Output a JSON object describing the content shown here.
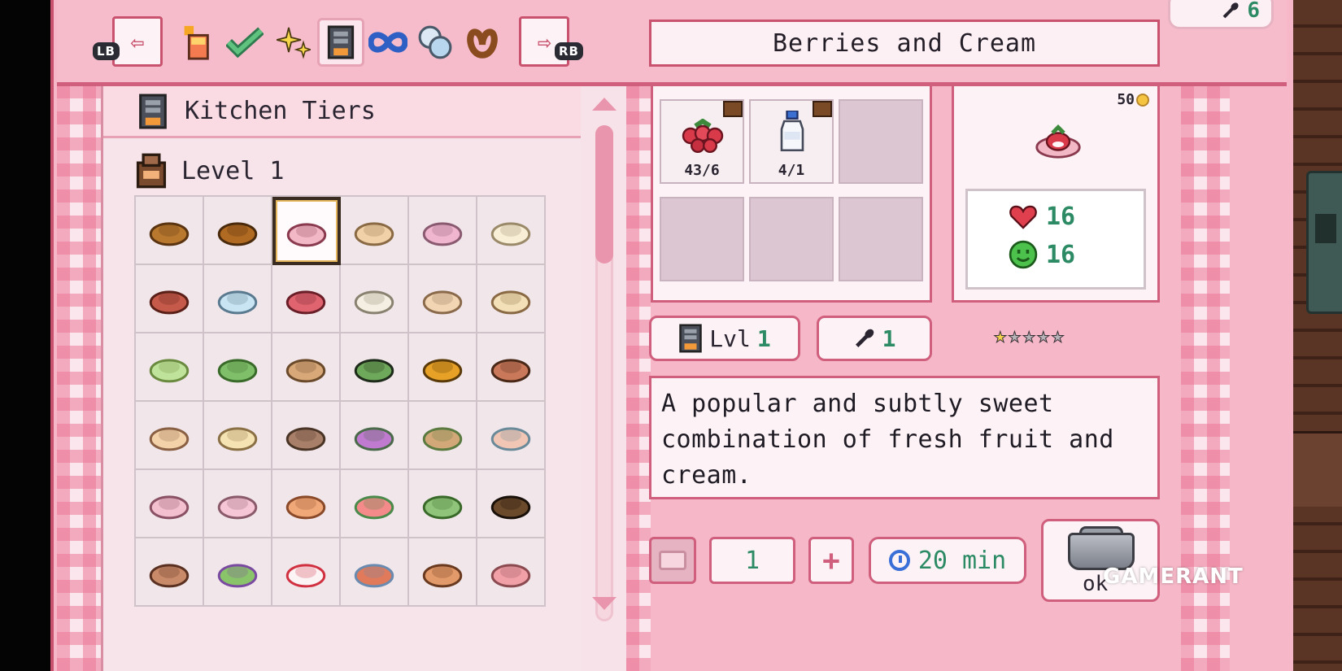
{
  "colors": {
    "accent": "#cf5f7c",
    "panel": "#f6b8c8",
    "value_green": "#2c8b64"
  },
  "topbar": {
    "left_button": {
      "icon": "arrow-left-icon",
      "badge": "LB"
    },
    "right_button": {
      "icon": "arrow-right-icon",
      "badge": "RB"
    },
    "category_tabs": [
      {
        "icon": "drink-icon",
        "selected": false
      },
      {
        "icon": "checkmark-icon",
        "selected": false
      },
      {
        "icon": "sparkle-icon",
        "selected": false
      },
      {
        "icon": "kitchen-tier-icon",
        "selected": true
      },
      {
        "icon": "infinity-icon",
        "selected": false
      },
      {
        "icon": "gems-icon",
        "selected": false
      },
      {
        "icon": "pretzel-icon",
        "selected": false
      }
    ],
    "recipe_title": "Berries and Cream",
    "fork_count": "6"
  },
  "list": {
    "section_title": "Kitchen Tiers",
    "level_title": "Level 1"
  },
  "recipes": [
    {
      "icon": "potato-icon",
      "selected": false
    },
    {
      "icon": "bread-roll-icon",
      "selected": false
    },
    {
      "icon": "berries-cream-icon",
      "selected": true
    },
    {
      "icon": "bread-loaf-icon",
      "selected": false
    },
    {
      "icon": "pink-soup-icon",
      "selected": false
    },
    {
      "icon": "egg-plate-icon",
      "selected": false
    },
    {
      "icon": "skewer-icon",
      "selected": false
    },
    {
      "icon": "candy-icon",
      "selected": false
    },
    {
      "icon": "berry-juice-icon",
      "selected": false
    },
    {
      "icon": "rice-bowl-icon",
      "selected": false
    },
    {
      "icon": "toast-plate-icon",
      "selected": false
    },
    {
      "icon": "tofu-icon",
      "selected": false
    },
    {
      "icon": "salad-plate-icon",
      "selected": false
    },
    {
      "icon": "green-soup-icon",
      "selected": false
    },
    {
      "icon": "squid-icon",
      "selected": false
    },
    {
      "icon": "tea-cup-icon",
      "selected": false
    },
    {
      "icon": "corn-icon",
      "selected": false
    },
    {
      "icon": "egg-icon",
      "selected": false
    },
    {
      "icon": "sandwich-icon",
      "selected": false
    },
    {
      "icon": "cake-slice-icon",
      "selected": false
    },
    {
      "icon": "pie-icon",
      "selected": false
    },
    {
      "icon": "dango-icon",
      "selected": false
    },
    {
      "icon": "toast-sandwich-icon",
      "selected": false
    },
    {
      "icon": "drink-cup-icon",
      "selected": false
    },
    {
      "icon": "onigiri-icon",
      "selected": false
    },
    {
      "icon": "pink-plate-icon",
      "selected": false
    },
    {
      "icon": "dumplings-icon",
      "selected": false
    },
    {
      "icon": "watermelon-icon",
      "selected": false
    },
    {
      "icon": "veggie-bowl-icon",
      "selected": false
    },
    {
      "icon": "dark-bowl-icon",
      "selected": false
    },
    {
      "icon": "meat-bun-icon",
      "selected": false
    },
    {
      "icon": "herb-salad-icon",
      "selected": false
    },
    {
      "icon": "strawberry-daifuku-icon",
      "selected": false
    },
    {
      "icon": "stew-icon",
      "selected": false
    },
    {
      "icon": "ramen-icon",
      "selected": false
    },
    {
      "icon": "sushi-icon",
      "selected": false
    }
  ],
  "ingredients": [
    {
      "icon": "red-berries-icon",
      "qty": "43/6",
      "storage": "chest-icon"
    },
    {
      "icon": "milk-bottle-icon",
      "qty": "4/1",
      "storage": "chest-icon"
    }
  ],
  "dish": {
    "price": "50",
    "icon": "berries-cream-icon",
    "hearts": "16",
    "energy": "16"
  },
  "meta": {
    "kitchen_level_label": "Lvl",
    "kitchen_level_value": "1",
    "fork_value": "1",
    "stars_filled": 1,
    "stars_total": 5
  },
  "description": "A popular and subtly sweet combination of fresh fruit and cream.",
  "cook": {
    "quantity": "1",
    "time": "20 min",
    "button_label": "ok"
  },
  "watermark": "GAMERANT"
}
